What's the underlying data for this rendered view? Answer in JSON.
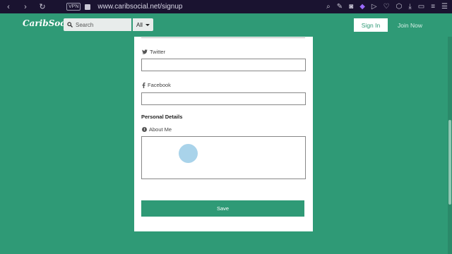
{
  "browser": {
    "back_glyph": "‹",
    "forward_glyph": "›",
    "reload_glyph": "↻",
    "vpn_label": "VPN",
    "url": "www.caribsocial.net/signup"
  },
  "site": {
    "logo": "CaribSocial",
    "search_placeholder": "Search",
    "filter_label": "All",
    "signin_label": "Sign In",
    "joinnow_label": "Join Now"
  },
  "form": {
    "twitter_label": "Twitter",
    "facebook_label": "Facebook",
    "personal_details_title": "Personal Details",
    "about_label": "About Me",
    "save_label": "Save"
  },
  "colors": {
    "page_bg": "#2f9a76",
    "chrome_bg": "#1a1330",
    "accent": "#2f9a76"
  }
}
